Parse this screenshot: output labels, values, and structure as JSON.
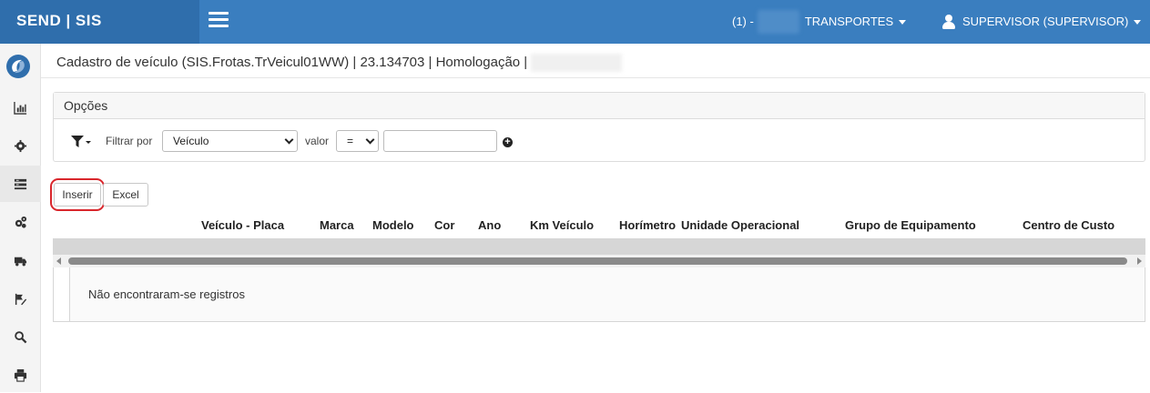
{
  "topbar": {
    "brand": "SEND | SIS",
    "company_prefix": "(1) -",
    "company_name": "TRANSPORTES",
    "user": "SUPERVISOR (SUPERVISOR)",
    "colors": {
      "bar": "#3a7ebf",
      "brand_bg": "#2f6eac"
    }
  },
  "sidebar": {
    "items": [
      {
        "icon": "bar-chart-icon"
      },
      {
        "icon": "gear-icon"
      },
      {
        "icon": "list-icon"
      },
      {
        "icon": "gears-icon"
      },
      {
        "icon": "truck-icon"
      },
      {
        "icon": "flag-edit-icon"
      },
      {
        "icon": "search-icon"
      },
      {
        "icon": "print-icon"
      }
    ]
  },
  "page": {
    "title": "Cadastro de veículo (SIS.Frotas.TrVeicul01WW) | 23.134703 | Homologação |"
  },
  "options": {
    "heading": "Opções",
    "filter_label": "Filtrar por",
    "filter_field": "Veículo",
    "value_label": "valor",
    "operator": "=",
    "value_input": ""
  },
  "actions": {
    "insert_label": "Inserir",
    "excel_label": "Excel",
    "highlight_color": "#d9262c"
  },
  "table": {
    "columns": [
      "Veículo - Placa",
      "Marca",
      "Modelo",
      "Cor",
      "Ano",
      "Km Veículo",
      "Horímetro",
      "Unidade Operacional",
      "Grupo de Equipamento",
      "Centro de Custo"
    ],
    "empty_message": "Não encontraram-se registros"
  }
}
